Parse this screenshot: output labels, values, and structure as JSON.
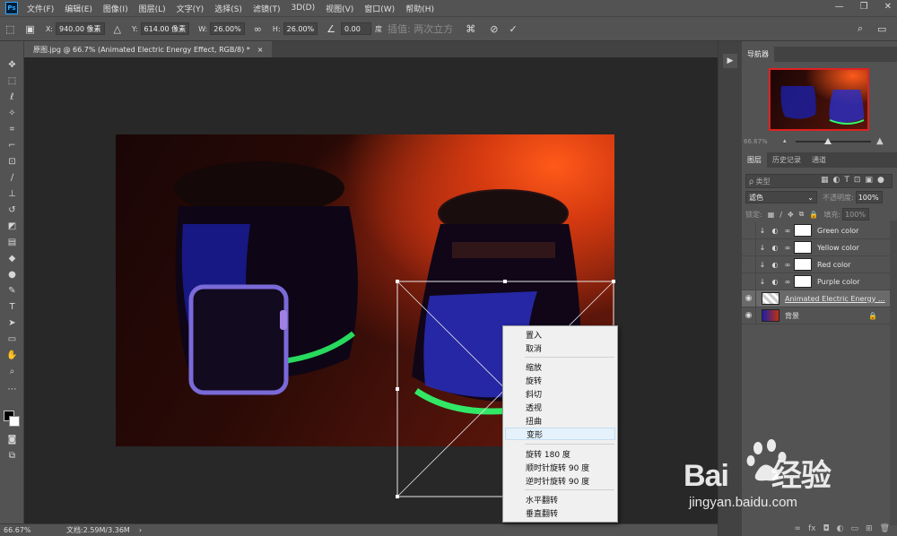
{
  "menubar": {
    "logo": "Ps",
    "items": [
      "文件(F)",
      "编辑(E)",
      "图像(I)",
      "图层(L)",
      "文字(Y)",
      "选择(S)",
      "滤镜(T)",
      "3D(D)",
      "视图(V)",
      "窗口(W)",
      "帮助(H)"
    ],
    "window_controls": [
      "—",
      "❐",
      "✕"
    ]
  },
  "options": {
    "x_label": "X:",
    "x_value": "940.00 像素",
    "y_label": "Y:",
    "y_value": "614.00 像素",
    "w_label": "W:",
    "w_value": "26.00%",
    "h_label": "H:",
    "h_value": "26.00%",
    "angle_value": "0.00",
    "angle_unit": "度",
    "interp_label": "插值:",
    "interp_value": "两次立方"
  },
  "document": {
    "tab_title": "原图.jpg @ 66.7% (Animated Electric Energy Effect, RGB/8) *",
    "tab_close": "×"
  },
  "status": {
    "zoom": "66.67%",
    "doc_info": "文档:2.59M/3.36M",
    "arrow": "›"
  },
  "navigator": {
    "tab": "导航器",
    "zoom": "66.67%"
  },
  "layers_panel": {
    "tabs": [
      "图层",
      "历史记录",
      "通道"
    ],
    "search_placeholder": "ρ 类型",
    "blend_mode": "滤色",
    "opacity_label": "不透明度:",
    "opacity_value": "100%",
    "lock_label": "锁定:",
    "fill_label": "填充:",
    "fill_value": "100%",
    "layers": [
      {
        "name": "Green color",
        "visible": false,
        "selected": false
      },
      {
        "name": "Yellow color",
        "visible": false,
        "selected": false
      },
      {
        "name": "Red color",
        "visible": false,
        "selected": false
      },
      {
        "name": "Purple color",
        "visible": false,
        "selected": false
      },
      {
        "name": "Animated Electric Energy ...",
        "visible": true,
        "selected": true
      },
      {
        "name": "背景",
        "visible": true,
        "selected": false
      }
    ]
  },
  "context_menu": {
    "items": [
      "置入",
      "取消",
      "缩放",
      "旋转",
      "斜切",
      "透视",
      "扭曲",
      "变形",
      "旋转 180 度",
      "顺时针旋转 90 度",
      "逆时针旋转 90 度",
      "水平翻转",
      "垂直翻转"
    ],
    "hovered": "变形"
  },
  "watermark": {
    "brand": "Bai",
    "brand_suffix": "经验",
    "url": "jingyan.baidu.com"
  }
}
